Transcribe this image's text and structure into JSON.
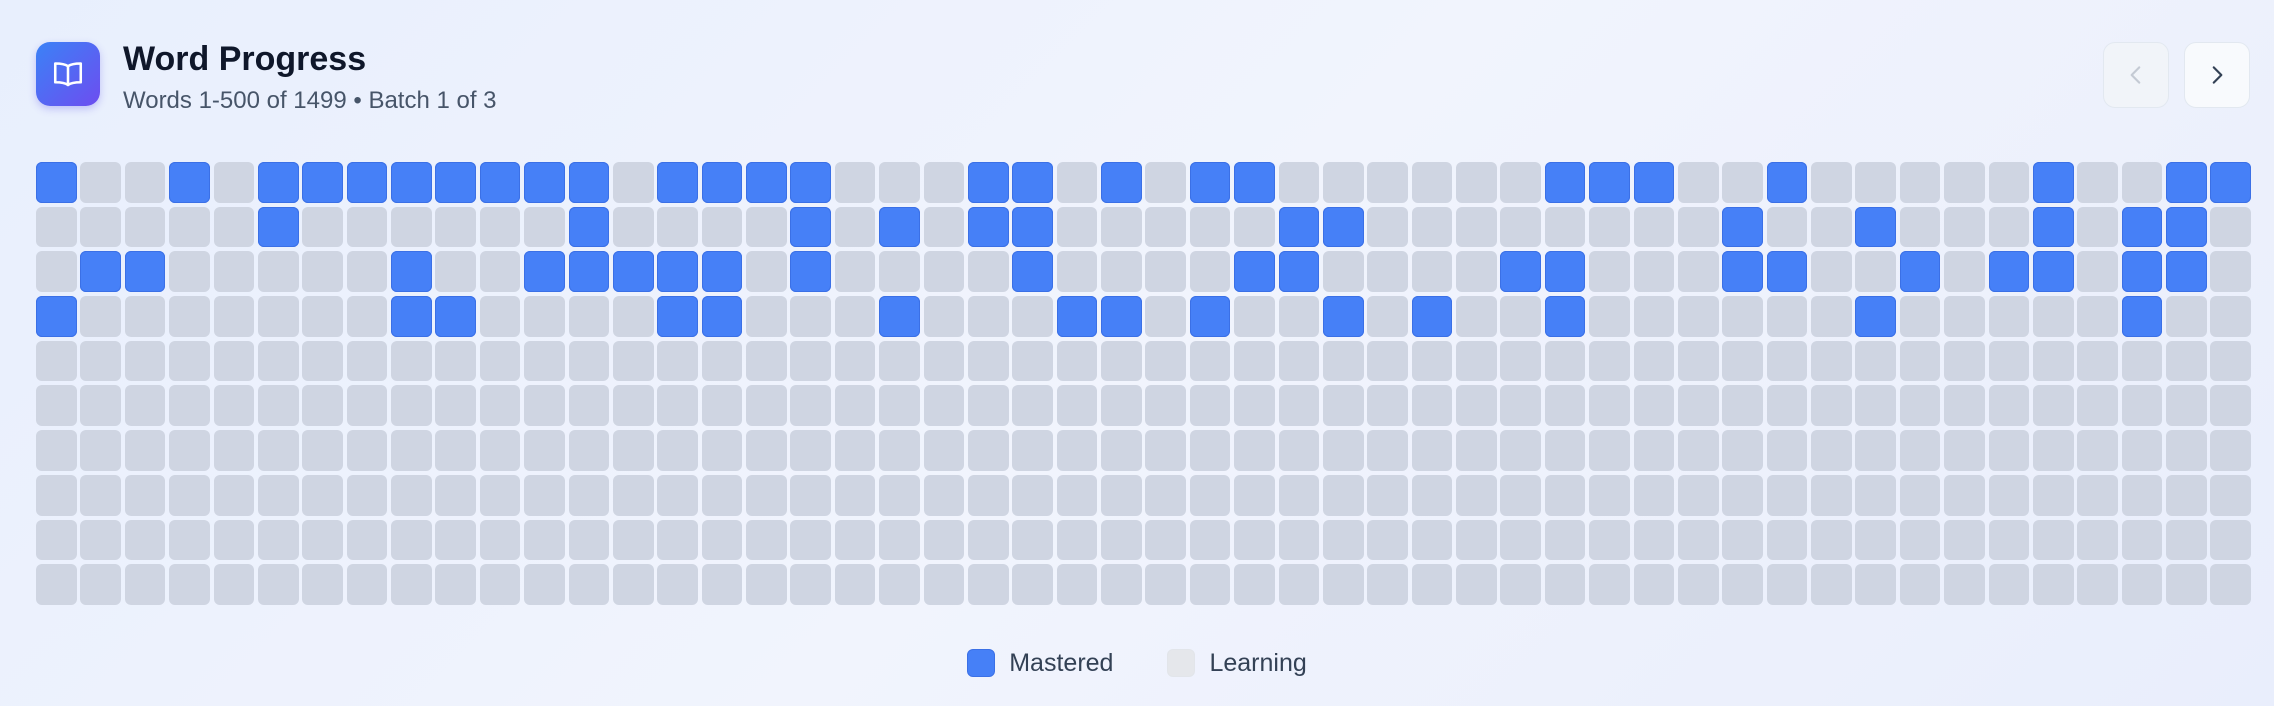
{
  "header": {
    "icon": "open-book-icon",
    "title": "Word Progress",
    "subtitle": "Words 1-500 of 1499 • Batch 1 of 3",
    "prev_icon": "chevron-left-icon",
    "next_icon": "chevron-right-icon",
    "prev_disabled": true
  },
  "grid": {
    "columns": 50,
    "rows": 10,
    "cells": [
      "10010111111110111100011010110000001110010000010011",
      "00000100000010000101011000001100000000100100010110",
      "01100000100111110100001000011000011000110010110110",
      "10000000110000110001000110100101001000000100000100",
      "00000000000000000000000000000000000000000000000000",
      "00000000000000000000000000000000000000000000000000",
      "00000000000000000000000000000000000000000000000000",
      "00000000000000000000000000000000000000000000000000",
      "00000000000000000000000000000000000000000000000000",
      "00000000000000000000000000000000000000000000000000"
    ]
  },
  "legend": {
    "items": [
      {
        "label": "Mastered",
        "color": "#4680f7"
      },
      {
        "label": "Learning",
        "color": "#e5e7eb"
      }
    ]
  },
  "colors": {
    "mastered": "#4680f7",
    "learning": "#cfd5e2",
    "accent": "#4f46e5"
  }
}
